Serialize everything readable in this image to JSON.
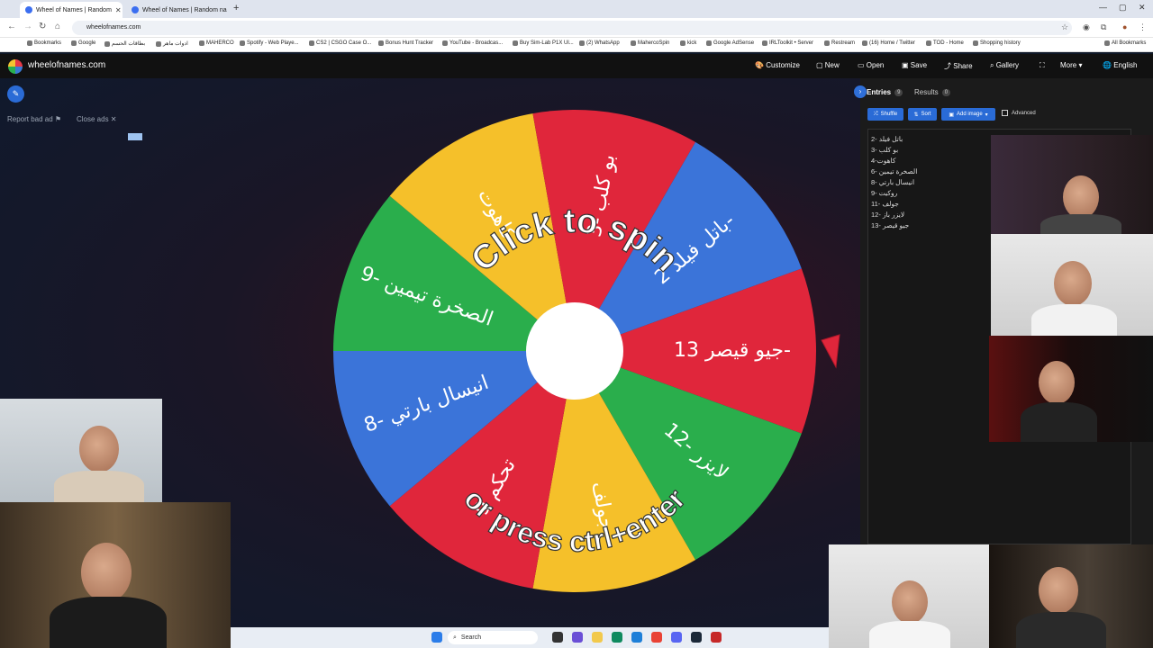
{
  "browser": {
    "tabs": [
      {
        "title": "Wheel of Names | Random",
        "active": true
      },
      {
        "title": "Wheel of Names | Random na",
        "active": false
      }
    ],
    "url": "wheelofnames.com",
    "bookmarks": [
      "Bookmarks",
      "Google",
      "بطاقات الحسم",
      "ادوات ماهر",
      "MAHERCO",
      "Spotify - Web Playe...",
      "CS2 | CSGO Case O...",
      "Bonus Hunt Tracker",
      "YouTube - Broadcas...",
      "Buy Sim-Lab P1X Ul...",
      "(2) WhatsApp",
      "MahercoSpin",
      "kick",
      "Google AdSense",
      "IRLToolkit • Server",
      "Restream",
      "(16) Home / Twitter",
      "TOD - Home",
      "Shopping history",
      "All Bookmarks"
    ]
  },
  "app": {
    "brand": "wheelofnames.com",
    "nav": [
      "Customize",
      "New",
      "Open",
      "Save",
      "Share",
      "Gallery",
      "More",
      "English"
    ],
    "report_bad_ad": "Report bad ad",
    "close_ads": "Close ads"
  },
  "wheel": {
    "center_top_text": "Click to spin",
    "center_bottom_text": "or press ctrl+enter",
    "colors": {
      "red": "#e0263b",
      "blue": "#3b74d9",
      "green": "#2aae4c",
      "yellow": "#f5c02a"
    },
    "segments": [
      {
        "label": "جيو قيصر 13-",
        "color": "red"
      },
      {
        "label": "12- لايزر",
        "color": "green"
      },
      {
        "label": "جولف",
        "color": "yellow"
      },
      {
        "label": "تحكم 9",
        "color": "red"
      },
      {
        "label": "8- انيسال بارتي",
        "color": "blue"
      },
      {
        "label": "9- الصخرة تيمين",
        "color": "green"
      },
      {
        "label": "كاهوت",
        "color": "yellow"
      },
      {
        "label": "3- بو كلب",
        "color": "red"
      },
      {
        "label": "باتل فيلد 2-",
        "color": "blue"
      }
    ]
  },
  "sidebar": {
    "tab_entries": "Entries",
    "entries_count": "9",
    "tab_results": "Results",
    "results_count": "0",
    "shuffle": "Shuffle",
    "sort": "Sort",
    "add_image": "Add image",
    "advanced": "Advanced",
    "entries": [
      "2- باتل فيلد",
      "3- بو كلب",
      "4-كاهوت",
      "6- الصخرة تيمين",
      "8- انيسال بارتي",
      "9- روكيت",
      "11- جولف",
      "12- لايزر باز",
      "13- جيو قيصر"
    ]
  },
  "taskbar": {
    "search": "Search"
  }
}
